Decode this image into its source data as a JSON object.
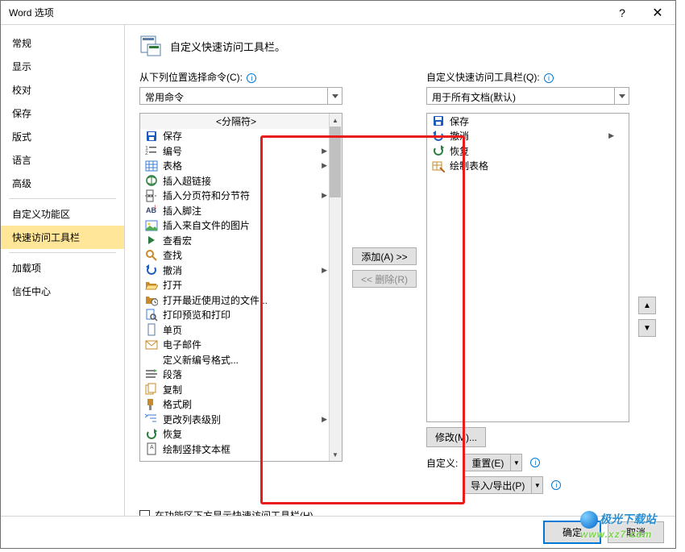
{
  "titlebar": {
    "title": "Word 选项",
    "help": "?",
    "close": "✕"
  },
  "sidebar": {
    "items": [
      {
        "label": "常规"
      },
      {
        "label": "显示"
      },
      {
        "label": "校对"
      },
      {
        "label": "保存"
      },
      {
        "label": "版式"
      },
      {
        "label": "语言"
      },
      {
        "label": "高级"
      }
    ],
    "items2": [
      {
        "label": "自定义功能区"
      },
      {
        "label": "快速访问工具栏"
      }
    ],
    "items3": [
      {
        "label": "加载项"
      },
      {
        "label": "信任中心"
      }
    ]
  },
  "header": {
    "text": "自定义快速访问工具栏。"
  },
  "left": {
    "label": "从下列位置选择命令(C):",
    "dropdown": "常用命令",
    "separator": "<分隔符>",
    "items": [
      {
        "icon": "save",
        "label": "保存",
        "color": "#1e5bbf"
      },
      {
        "icon": "numbering",
        "label": "编号",
        "arrow": true,
        "color": "#555"
      },
      {
        "icon": "table",
        "label": "表格",
        "arrow": true,
        "color": "#3b7dd8"
      },
      {
        "icon": "hyperlink",
        "label": "插入超链接",
        "color": "#2a7d3c"
      },
      {
        "icon": "pagebreak",
        "label": "插入分页符和分节符",
        "arrow": true,
        "color": "#555"
      },
      {
        "icon": "footnote",
        "label": "插入脚注",
        "color": "#346"
      },
      {
        "icon": "picfile",
        "label": "插入来自文件的图片",
        "color": "#3b7dd8"
      },
      {
        "icon": "macro",
        "label": "查看宏",
        "color": "#2a7d3c"
      },
      {
        "icon": "find",
        "label": "查找",
        "color": "#c78b2a"
      },
      {
        "icon": "undo",
        "label": "撤消",
        "arrow": true,
        "color": "#1e5bbf"
      },
      {
        "icon": "open",
        "label": "打开",
        "color": "#c78b2a"
      },
      {
        "icon": "recent",
        "label": "打开最近使用过的文件...",
        "color": "#c78b2a"
      },
      {
        "icon": "preview",
        "label": "打印预览和打印",
        "color": "#3b7dd8"
      },
      {
        "icon": "onepage",
        "label": "单页",
        "color": "#5577aa"
      },
      {
        "icon": "email",
        "label": "电子邮件",
        "color": "#c78b2a"
      },
      {
        "icon": "blank",
        "label": "定义新编号格式...",
        "color": "#555"
      },
      {
        "icon": "paragraph",
        "label": "段落",
        "color": "#555"
      },
      {
        "icon": "copy",
        "label": "复制",
        "color": "#c78b2a"
      },
      {
        "icon": "format",
        "label": "格式刷",
        "color": "#c78b2a"
      },
      {
        "icon": "listlvl",
        "label": "更改列表级别",
        "arrow": true,
        "color": "#3b7dd8"
      },
      {
        "icon": "redo",
        "label": "恢复",
        "color": "#2a7d3c"
      },
      {
        "icon": "textbox",
        "label": "绘制竖排文本框",
        "color": "#555"
      }
    ]
  },
  "mid": {
    "add": "添加(A) >>",
    "remove": "<< 删除(R)"
  },
  "right": {
    "label": "自定义快速访问工具栏(Q):",
    "dropdown": "用于所有文档(默认)",
    "items": [
      {
        "icon": "save",
        "label": "保存",
        "color": "#1e5bbf"
      },
      {
        "icon": "undo",
        "label": "撤消",
        "arrow": true,
        "color": "#1e5bbf"
      },
      {
        "icon": "redo",
        "label": "恢复",
        "color": "#2a7d3c"
      },
      {
        "icon": "drawtable",
        "label": "绘制表格",
        "color": "#c78b2a"
      }
    ],
    "modify": "修改(M)...",
    "custom_label": "自定义:",
    "reset": "重置(E)",
    "importexport": "导入/导出(P)"
  },
  "checkbox": {
    "label": "在功能区下方显示快速访问工具栏(H)"
  },
  "footer": {
    "ok": "确定",
    "cancel": "取消"
  },
  "watermark": {
    "top": "极光下载站",
    "bot": "www.xz7.com"
  }
}
